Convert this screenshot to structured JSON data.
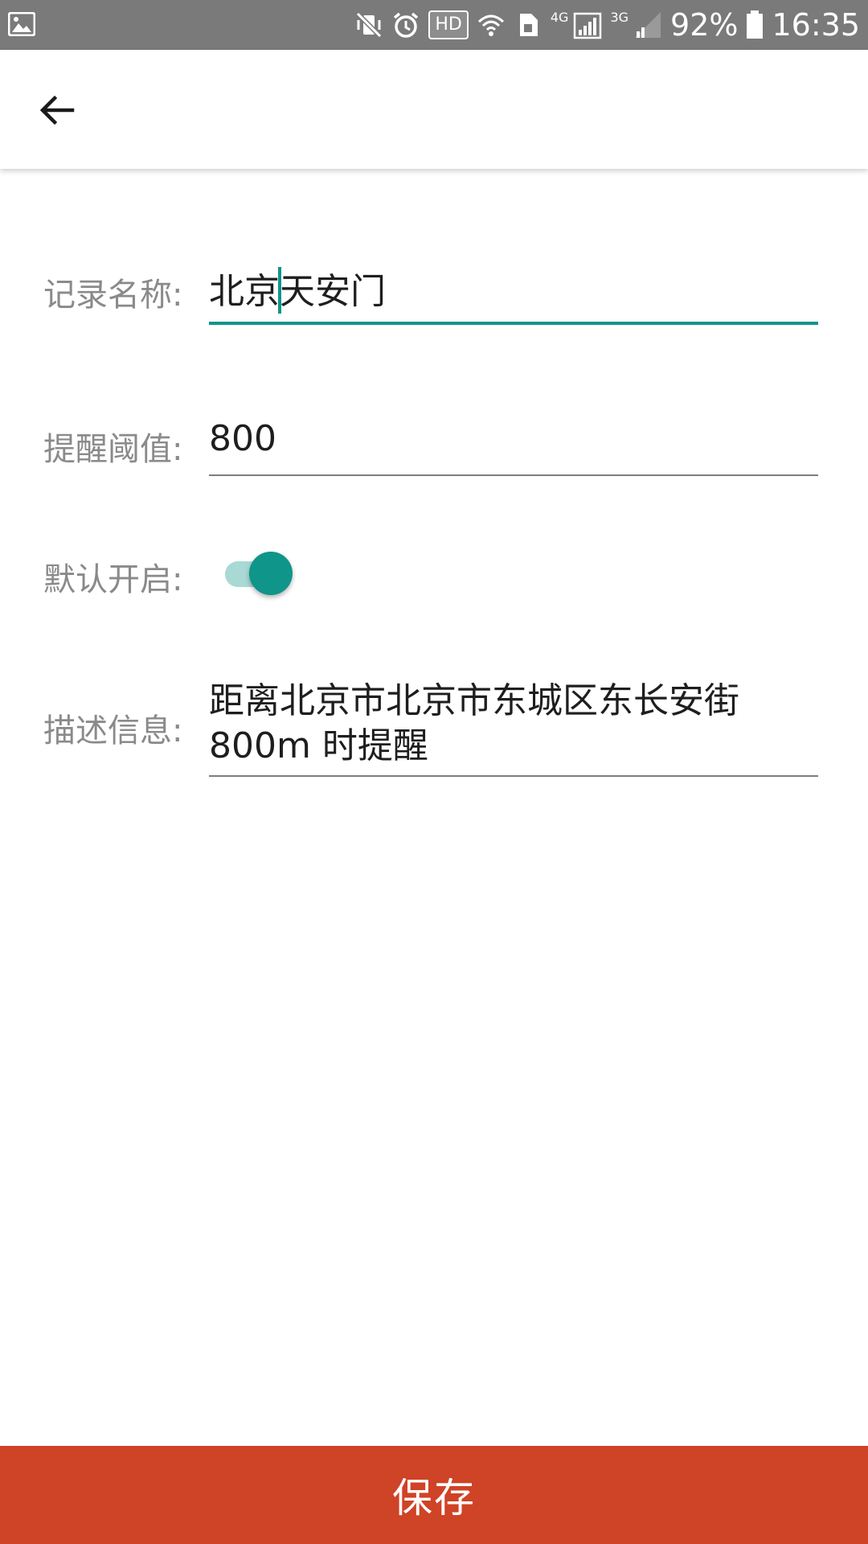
{
  "status_bar": {
    "icons": [
      "gallery-icon",
      "mute-vibrate-icon",
      "alarm-icon",
      "wifi-icon",
      "sim-icon",
      "signal-icon",
      "signal-weak-icon",
      "battery-icon"
    ],
    "hd_badge": "HD",
    "net_4g": "4G",
    "net_3g": "3G",
    "battery": "92%",
    "time": "16:35"
  },
  "toolbar": {
    "back_icon": "arrow-back-icon"
  },
  "form": {
    "name_label": "记录名称:",
    "name_value_before_cursor": "北京",
    "name_value_after_cursor": "天安门",
    "threshold_label": "提醒阈值:",
    "threshold_value": "800",
    "default_on_label": "默认开启:",
    "default_on": true,
    "description_label": "描述信息:",
    "description_line1": "距离北京市北京市东城区东长安街",
    "description_line2": "800m 时提醒"
  },
  "colors": {
    "accent": "#0f958a",
    "save_button": "#cf4326",
    "status_bar": "#7a7a7a"
  },
  "save_button": {
    "label": "保存"
  }
}
